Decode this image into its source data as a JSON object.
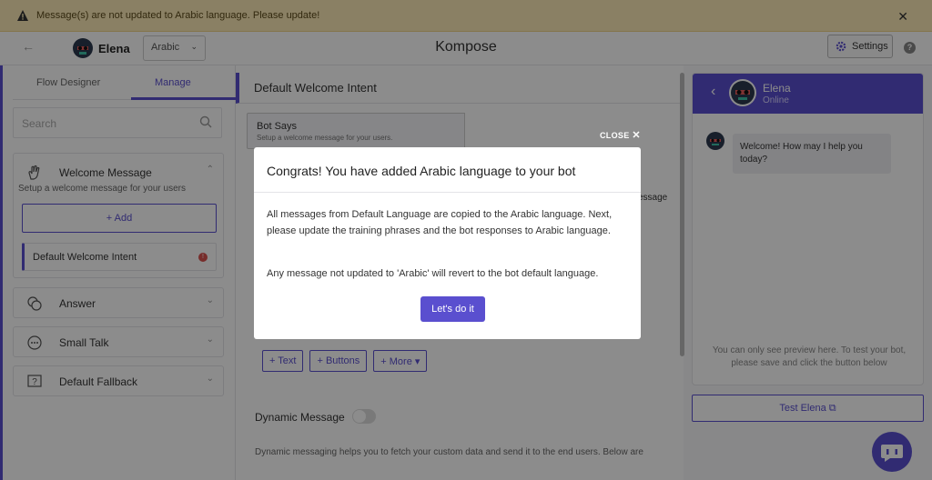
{
  "banner": {
    "message": "Message(s) are not updated to Arabic language. Please update!"
  },
  "topbar": {
    "bot_name": "Elena",
    "language": "Arabic",
    "app_title": "Kompose",
    "settings_label": "Settings"
  },
  "sidebar": {
    "tabs": [
      "Flow Designer",
      "Manage"
    ],
    "search_placeholder": "Search",
    "welcome": {
      "title": "Welcome Message",
      "description": "Setup a welcome message for your users",
      "add_label": "+ Add",
      "intent": "Default Welcome Intent"
    },
    "sections": [
      "Answer",
      "Small Talk",
      "Default Fallback"
    ]
  },
  "editor": {
    "header": "Default Welcome Intent",
    "bot_says_title": "Bot Says",
    "bot_says_sub": "Setup a welcome message for your users.",
    "message_tab_fragment": "essage",
    "buttons": [
      "+ Text",
      "+ Buttons",
      "+ More"
    ],
    "dynamic_label": "Dynamic Message",
    "dynamic_desc": "Dynamic messaging helps you to fetch your custom data and send it to the end users. Below are"
  },
  "preview": {
    "name": "Elena",
    "status": "Online",
    "message": "Welcome! How may I help you today?",
    "note": "You can only see preview here. To test your bot, please save and click the button below",
    "test_label": "Test Elena"
  },
  "modal": {
    "close_label": "CLOSE",
    "title": "Congrats! You have added Arabic language to your bot",
    "paragraph1": "All messages from Default Language are copied to the Arabic language. Next, please update the training phrases and the bot responses to Arabic language.",
    "paragraph2": "Any message not updated to 'Arabic' will revert to the bot default language.",
    "cta_label": "Let's do it"
  },
  "colors": {
    "accent": "#5a4fcf",
    "banner_bg": "#fbe9b7",
    "error": "#d9534f"
  }
}
